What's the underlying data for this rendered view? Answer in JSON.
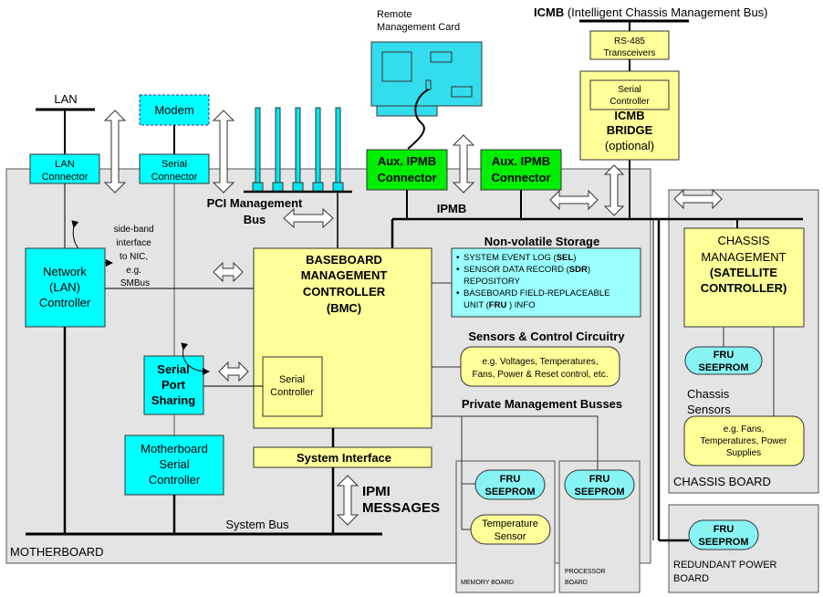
{
  "colors": {
    "board_bg": "#e4e4e4",
    "cyan": "#00ffff",
    "light_cyan": "#99ffff",
    "seeprom_cyan": "#88f4f4",
    "yellow": "#ffff99",
    "green": "#00ee00",
    "card_cyan": "#33ddee",
    "line": "#000000"
  },
  "top": {
    "lan": "LAN",
    "modem": "Modem",
    "remote_card": [
      "Remote",
      "Management Card"
    ],
    "icmb_bold": "ICMB",
    "icmb_rest": "(Intelligent Chassis Management Bus)",
    "rs485": [
      "RS-485",
      "Transceivers"
    ]
  },
  "icmb_bridge": {
    "serial": [
      "Serial",
      "Controller"
    ],
    "title": [
      "ICMB",
      "BRIDGE"
    ],
    "note": "(optional)"
  },
  "motherboard": {
    "label": "MOTHERBOARD",
    "lan_connector": [
      "LAN",
      "Connector"
    ],
    "serial_connector": [
      "Serial",
      "Connector"
    ],
    "pci_bus": [
      "PCI Management",
      "Bus"
    ],
    "aux_ipmb_1": [
      "Aux. IPMB",
      "Connector"
    ],
    "aux_ipmb_2": [
      "Aux. IPMB",
      "Connector"
    ],
    "ipmb": "IPMB",
    "sideband": [
      "side-band",
      "interface",
      "to NIC,",
      "e.g.",
      "SMBus"
    ],
    "nic": [
      "Network",
      "(LAN)",
      "Controller"
    ],
    "bmc": [
      "BASEBOARD",
      "MANAGEMENT",
      "CONTROLLER",
      "(BMC)"
    ],
    "bmc_serial": [
      "Serial",
      "Controller"
    ],
    "serial_port_sharing": [
      "Serial",
      "Port",
      "Sharing"
    ],
    "mb_serial": [
      "Motherboard",
      "Serial",
      "Controller"
    ],
    "system_interface": "System Interface",
    "ipmi_messages": [
      "IPMI",
      "MESSAGES"
    ],
    "system_bus": "System Bus",
    "nvs_title": "Non-volatile Storage",
    "nvs_items": [
      {
        "pre": "SYSTEM EVENT LOG (",
        "bold": "SEL",
        "post": ")"
      },
      {
        "pre": "SENSOR DATA RECORD (",
        "bold": "SDR",
        "post": ")"
      },
      {
        "pre": "REPOSITORY",
        "bold": "",
        "post": ""
      },
      {
        "pre": "BASEBOARD FIELD-REPLACEABLE",
        "bold": "",
        "post": ""
      },
      {
        "pre": "UNIT (",
        "bold": "FRU",
        "post": " ) INFO"
      }
    ],
    "sensors_title": "Sensors & Control Circuitry",
    "sensors_box": [
      "e.g. Voltages, Temperatures,",
      "Fans, Power & Reset control, etc."
    ],
    "private_busses": "Private Management Busses"
  },
  "memory_board": {
    "label": "MEMORY BOARD",
    "fru": [
      "FRU",
      "SEEPROM"
    ],
    "temp": [
      "Temperature",
      "Sensor"
    ]
  },
  "processor_board": {
    "label": [
      "PROCESSOR",
      "BOARD"
    ],
    "fru": [
      "FRU",
      "SEEPROM"
    ]
  },
  "chassis_board": {
    "label": "CHASSIS BOARD",
    "controller": [
      "CHASSIS",
      "MANAGEMENT",
      "(SATELLITE",
      "CONTROLLER)"
    ],
    "fru": [
      "FRU",
      "SEEPROM"
    ],
    "sensors_label": [
      "Chassis",
      "Sensors"
    ],
    "sensors_box": [
      "e.g. Fans,",
      "Temperatures, Power",
      "Supplies"
    ]
  },
  "power_board": {
    "label": [
      "REDUNDANT POWER",
      "BOARD"
    ],
    "fru": [
      "FRU",
      "SEEPROM"
    ]
  }
}
